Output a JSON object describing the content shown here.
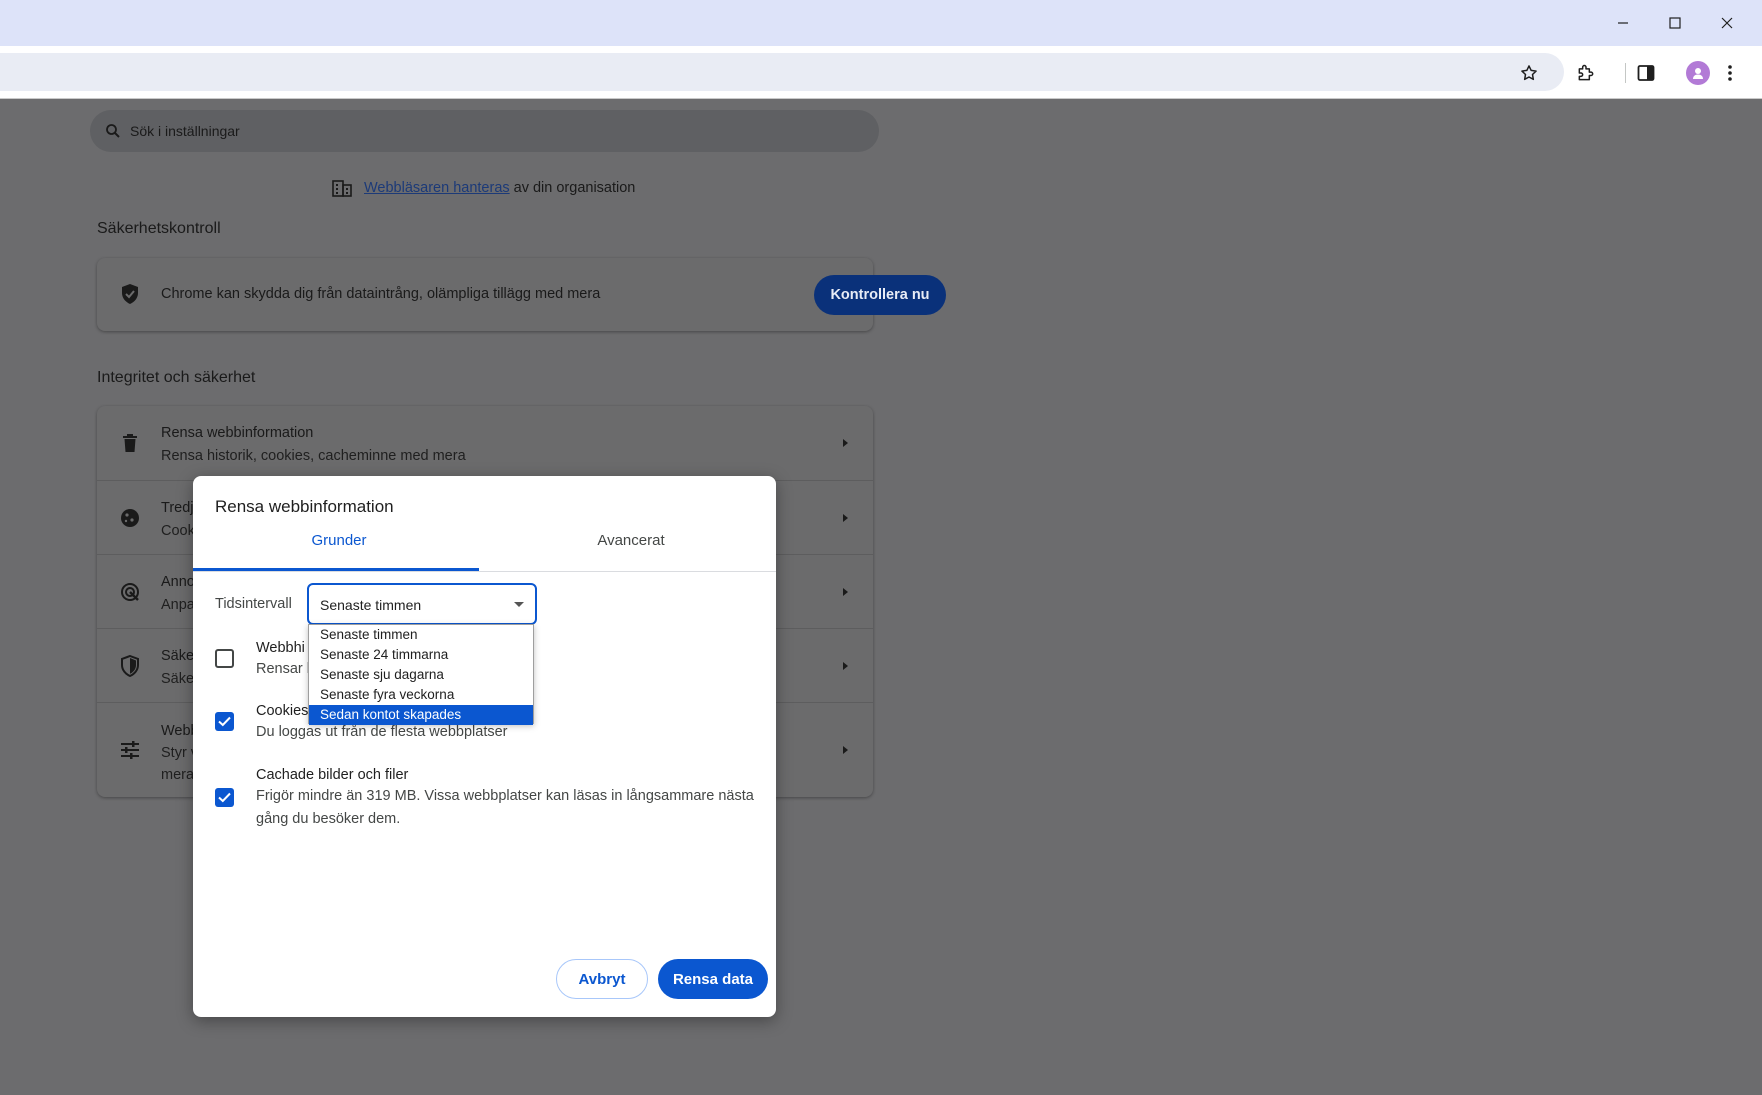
{
  "search": {
    "placeholder": "Sök i inställningar"
  },
  "managed": {
    "link": "Webbläsaren hanteras",
    "suffix": "av din organisation"
  },
  "safety_check": {
    "title": "Säkerhetskontroll",
    "text": "Chrome kan skydda dig från dataintrång, olämpliga tillägg med mera",
    "button": "Kontrollera nu"
  },
  "privacy": {
    "title": "Integritet och säkerhet",
    "rows": [
      {
        "title": "Rensa webbinformation",
        "sub": "Rensa historik, cookies, cacheminne med mera"
      },
      {
        "title": "Tredj",
        "sub": "Cook"
      },
      {
        "title": "Anno",
        "sub": "Anpa"
      },
      {
        "title": "Säke",
        "sub": "Säke"
      },
      {
        "title": "Webb",
        "sub": "Styr v",
        "sub2": "mera"
      }
    ]
  },
  "dialog": {
    "title": "Rensa webbinformation",
    "tabs": [
      "Grunder",
      "Avancerat"
    ],
    "time_range_label": "Tidsintervall",
    "time_range_value": "Senaste timmen",
    "options": [
      {
        "title": "Webbhi",
        "sub": "Rensar h",
        "checked": false
      },
      {
        "title": "Cookies",
        "sub": "Du loggas ut från de flesta webbplatser",
        "checked": true
      },
      {
        "title": "Cachade bilder och filer",
        "sub": "Frigör mindre än 319 MB. Vissa webbplatser kan läsas in långsammare nästa gång du besöker dem.",
        "checked": true
      }
    ],
    "cancel": "Avbryt",
    "confirm": "Rensa data"
  },
  "dropdown": {
    "items": [
      "Senaste timmen",
      "Senaste 24 timmarna",
      "Senaste sju dagarna",
      "Senaste fyra veckorna",
      "Sedan kontot skapades"
    ],
    "highlighted": "Sedan kontot skapades"
  }
}
